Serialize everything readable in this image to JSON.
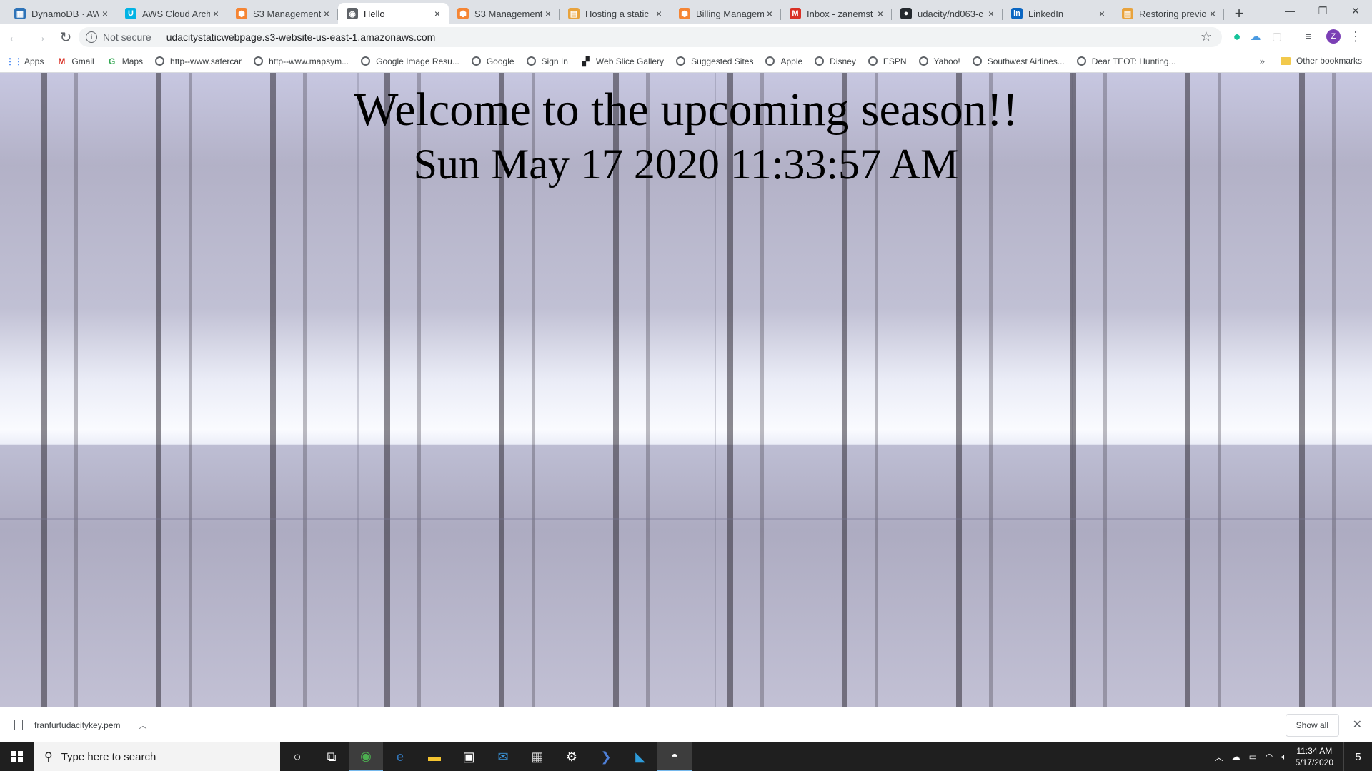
{
  "browser": {
    "tabs": [
      {
        "title": "DynamoDB · AWS",
        "icon": "dynamodb-icon",
        "color": "#2e73b8",
        "glyph": "▦"
      },
      {
        "title": "AWS Cloud Architect",
        "icon": "udacity-icon",
        "color": "#02b3e4",
        "glyph": "U"
      },
      {
        "title": "S3 Management",
        "icon": "aws-s3-icon",
        "color": "#f58534",
        "glyph": "⬢"
      },
      {
        "title": "Hello",
        "icon": "globe-icon",
        "color": "#5f6368",
        "glyph": "◉",
        "active": true
      },
      {
        "title": "S3 Management",
        "icon": "aws-s3-icon",
        "color": "#f58534",
        "glyph": "⬢"
      },
      {
        "title": "Hosting a static",
        "icon": "aws-docs-icon",
        "color": "#e8a33d",
        "glyph": "▤"
      },
      {
        "title": "Billing Management",
        "icon": "aws-billing-icon",
        "color": "#f58534",
        "glyph": "⬢"
      },
      {
        "title": "Inbox - zanemst",
        "icon": "gmail-icon",
        "color": "#d93025",
        "glyph": "M"
      },
      {
        "title": "udacity/nd063-c",
        "icon": "github-icon",
        "color": "#24292e",
        "glyph": "●"
      },
      {
        "title": "LinkedIn",
        "icon": "linkedin-icon",
        "color": "#0a66c2",
        "glyph": "in"
      },
      {
        "title": "Restoring previous",
        "icon": "aws-docs-icon",
        "color": "#e8a33d",
        "glyph": "▤"
      }
    ],
    "new_tab": "+",
    "window_controls": {
      "minimize": "—",
      "restore": "❐",
      "close": "✕"
    }
  },
  "toolbar": {
    "back": "←",
    "forward": "→",
    "reload": "↻",
    "security_label": "Not secure",
    "url": "udacitystaticwebpage.s3-website-us-east-1.amazonaws.com",
    "star": "☆",
    "profile_initial": "Z",
    "menu": "⋮"
  },
  "bookmarks": {
    "items": [
      {
        "label": "Apps",
        "icon": "apps-grid-icon"
      },
      {
        "label": "Gmail",
        "icon": "gmail-icon"
      },
      {
        "label": "Maps",
        "icon": "google-maps-icon"
      },
      {
        "label": "http--www.safercar",
        "icon": "globe-icon"
      },
      {
        "label": "http--www.mapsym...",
        "icon": "globe-icon"
      },
      {
        "label": "Google Image Resu...",
        "icon": "globe-icon"
      },
      {
        "label": "Google",
        "icon": "globe-icon"
      },
      {
        "label": "Sign In",
        "icon": "globe-icon"
      },
      {
        "label": "Web Slice Gallery",
        "icon": "web-slice-icon"
      },
      {
        "label": "Suggested Sites",
        "icon": "globe-icon"
      },
      {
        "label": "Apple",
        "icon": "globe-icon"
      },
      {
        "label": "Disney",
        "icon": "globe-icon"
      },
      {
        "label": "ESPN",
        "icon": "globe-icon"
      },
      {
        "label": "Yahoo!",
        "icon": "globe-icon"
      },
      {
        "label": "Southwest Airlines...",
        "icon": "globe-icon"
      },
      {
        "label": "Dear TEOT: Hunting...",
        "icon": "globe-icon"
      }
    ],
    "more": "»",
    "other": "Other bookmarks"
  },
  "page": {
    "heading": "Welcome to the upcoming season!!",
    "datetime": "Sun May 17 2020 11:33:57 AM",
    "background": "snowy-forest-tiled-image"
  },
  "downloads": {
    "file_name": "franfurtudacitykey.pem",
    "show_all": "Show all",
    "close": "✕"
  },
  "taskbar": {
    "search_placeholder": "Type here to search",
    "apps": [
      {
        "name": "cortana-icon",
        "glyph": "○"
      },
      {
        "name": "task-view-icon",
        "glyph": "⧉"
      },
      {
        "name": "chrome-icon",
        "glyph": "◉",
        "color": "#4caf50",
        "active": true
      },
      {
        "name": "edge-icon",
        "glyph": "e",
        "color": "#3277bc"
      },
      {
        "name": "file-explorer-icon",
        "glyph": "▬",
        "color": "#f4c430"
      },
      {
        "name": "store-icon",
        "glyph": "▣",
        "color": "#ffffff"
      },
      {
        "name": "mail-icon",
        "glyph": "✉",
        "color": "#3a96dd"
      },
      {
        "name": "calculator-icon",
        "glyph": "▦",
        "color": "#dddddd"
      },
      {
        "name": "settings-icon",
        "glyph": "⚙",
        "color": "#ffffff"
      },
      {
        "name": "powershell-icon",
        "glyph": "❯",
        "color": "#4e7fd6"
      },
      {
        "name": "vscode-icon",
        "glyph": "◣",
        "color": "#2d9cdb"
      },
      {
        "name": "photos-icon",
        "glyph": "◓",
        "color": "#ffffff",
        "active": true
      }
    ],
    "time": "11:34 AM",
    "date": "5/17/2020",
    "notifications": "5"
  }
}
